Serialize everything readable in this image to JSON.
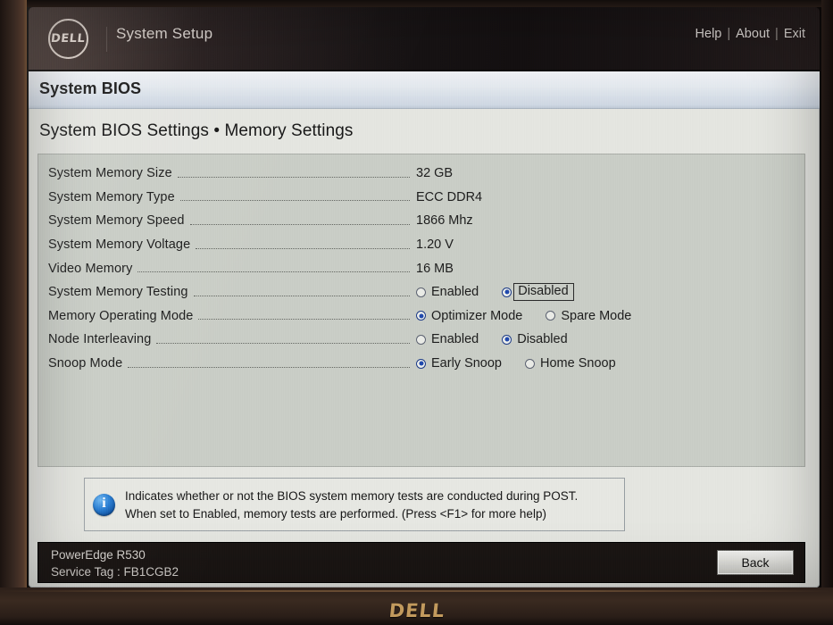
{
  "header": {
    "logo_text": "DELL",
    "logo_icon": "dell-logo-icon",
    "title": "System Setup",
    "links": [
      {
        "label": "Help"
      },
      {
        "label": "About"
      },
      {
        "label": "Exit"
      }
    ],
    "separator": "|"
  },
  "window": {
    "title": "System BIOS",
    "breadcrumb": "System BIOS Settings • Memory Settings"
  },
  "settings": [
    {
      "label": "System Memory Size",
      "type": "value",
      "value": "32 GB"
    },
    {
      "label": "System Memory Type",
      "type": "value",
      "value": "ECC DDR4"
    },
    {
      "label": "System Memory Speed",
      "type": "value",
      "value": "1866 Mhz"
    },
    {
      "label": "System Memory Voltage",
      "type": "value",
      "value": "1.20 V"
    },
    {
      "label": "Video Memory",
      "type": "value",
      "value": "16 MB"
    },
    {
      "label": "System Memory Testing",
      "type": "radio",
      "options": [
        {
          "label": "Enabled",
          "selected": false,
          "focused": false
        },
        {
          "label": "Disabled",
          "selected": true,
          "focused": true
        }
      ]
    },
    {
      "label": "Memory Operating Mode",
      "type": "radio",
      "options": [
        {
          "label": "Optimizer Mode",
          "selected": true,
          "focused": false
        },
        {
          "label": "Spare Mode",
          "selected": false,
          "focused": false
        }
      ]
    },
    {
      "label": "Node Interleaving",
      "type": "radio",
      "options": [
        {
          "label": "Enabled",
          "selected": false,
          "focused": false
        },
        {
          "label": "Disabled",
          "selected": true,
          "focused": false
        }
      ]
    },
    {
      "label": "Snoop Mode",
      "type": "radio",
      "options": [
        {
          "label": "Early Snoop",
          "selected": true,
          "focused": false
        },
        {
          "label": "Home Snoop",
          "selected": false,
          "focused": false
        }
      ]
    }
  ],
  "help": {
    "icon": "info-icon",
    "lines": [
      "Indicates whether or not the BIOS system memory tests are conducted during POST.",
      "When set to Enabled, memory tests are performed. (Press <F1> for more help)"
    ]
  },
  "footer": {
    "model": "PowerEdge R530",
    "service_tag": "Service Tag : FB1CGB2",
    "back_label": "Back"
  },
  "bezel": {
    "logo_text": "DELL"
  },
  "colors": {
    "accent_blue": "#1f48ad",
    "info_blue": "#2a7fd4",
    "panel_bg": "#c9cdc6",
    "window_bg": "#e4e5e0",
    "footer_bg": "#1a1513",
    "bezel_logo": "#c29a5d"
  }
}
